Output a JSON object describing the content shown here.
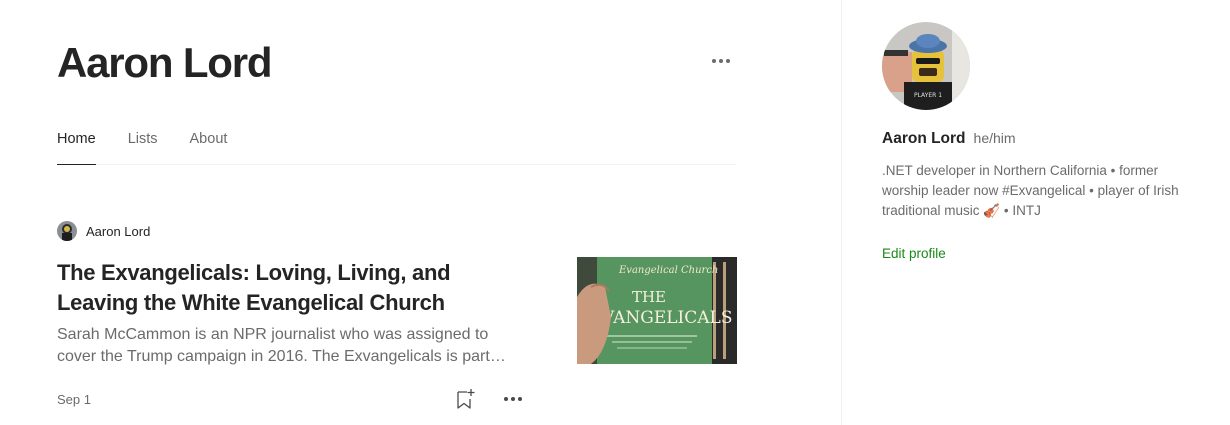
{
  "profile": {
    "name": "Aaron Lord"
  },
  "tabs": [
    {
      "label": "Home",
      "active": true
    },
    {
      "label": "Lists",
      "active": false
    },
    {
      "label": "About",
      "active": false
    }
  ],
  "post": {
    "author": "Aaron Lord",
    "title": "The Exvangelicals: Loving, Living, and Leaving the White Evangelical Church",
    "excerpt": "Sarah McCammon is an NPR journalist who was assigned to cover the Trump campaign in 2016. The Exvangelicals is part…",
    "date": "Sep 1",
    "thumbnail": {
      "top_line": "Evangelical Church",
      "title": "THE EXVANGELICALS"
    }
  },
  "sidebar": {
    "name": "Aaron Lord",
    "pronouns": "he/him",
    "bio": ".NET developer in Northern California • former worship leader now #Exvangelical • player of Irish traditional music 🎻 • INTJ",
    "edit_label": "Edit profile",
    "avatar_badge": "PLAYER 1"
  },
  "colors": {
    "accent_green": "#1a8917",
    "text_primary": "#242424",
    "text_secondary": "#6b6b6b"
  },
  "icons": [
    "more-icon",
    "bookmark-add-icon"
  ]
}
